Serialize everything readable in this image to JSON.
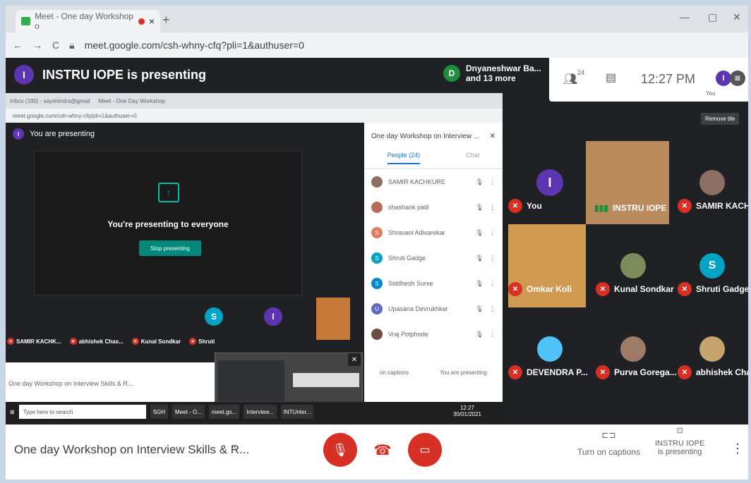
{
  "browser": {
    "tab_title": "Meet - One day Workshop o",
    "url": "meet.google.com/csh-whny-cfq?pli=1&authuser=0",
    "new_tab": "+",
    "tab_close": "×"
  },
  "banner": {
    "presenter_initial": "I",
    "presenter_text": "INSTRU IOPE is presenting"
  },
  "participants_chip": {
    "initial": "D",
    "line1": "Dnyaneshwar Ba...",
    "line2": "and 13 more"
  },
  "topbar": {
    "people_count": "24",
    "time": "12:27 PM",
    "you_label": "You",
    "remove_tile": "Remove tile"
  },
  "shared_screen": {
    "inner_tab1": "Inbox (190) - sayshindra@gmail",
    "inner_tab2": "Meet - One Day Workshop",
    "inner_url": "meet.google.com/csh-whny-cfq/pli=1&authuser=0",
    "you_are_presenting": "You are presenting",
    "presenting_to_everyone": "You're presenting to everyone",
    "stop_presenting": "Stop presenting",
    "panel_title": "One day Workshop on Interview ...",
    "people_tab": "People (24)",
    "chat_tab": "Chat",
    "people": [
      {
        "name": "SAMIR KACHKURE",
        "initial": "",
        "color": "#8d6e63"
      },
      {
        "name": "shashank patil",
        "initial": "",
        "color": "#b56c5a"
      },
      {
        "name": "Shravani Adivarekar",
        "initial": "S",
        "color": "#e07b5f"
      },
      {
        "name": "Shruti Gadge",
        "initial": "S",
        "color": "#00a3c4"
      },
      {
        "name": "Siddhesh Surve",
        "initial": "S",
        "color": "#0288d1"
      },
      {
        "name": "Upasana Devrukhkar",
        "initial": "U",
        "color": "#5c6bc0"
      },
      {
        "name": "Vraj Potphode",
        "initial": "",
        "color": "#6d4c41"
      }
    ],
    "strip": [
      {
        "name": "SAMIR KACHK..."
      },
      {
        "name": "abhishek Chas..."
      },
      {
        "name": "Kunal Sondkar"
      },
      {
        "name": "Shruti"
      }
    ],
    "strip_initial_s": "S",
    "strip_initial_i": "I",
    "meeting_title": "One day Workshop on Interview Skills & R...",
    "captions": "on captions",
    "you_are_presenting_btn": "You are presenting",
    "taskbar": {
      "search": "Type here to search",
      "items": [
        "SGH",
        "Meet - O...",
        "meet.go...",
        "Interview...",
        "INTUnter..."
      ],
      "time": "12:27",
      "date": "30/01/2021"
    }
  },
  "tiles": [
    {
      "name": "You",
      "initial": "I",
      "color": "#5e35b1",
      "type": "avatar"
    },
    {
      "name": "INSTRU IOPE",
      "type": "video"
    },
    {
      "name": "SAMIR KACH...",
      "type": "photo"
    },
    {
      "name": "Omkar Koli",
      "type": "video2"
    },
    {
      "name": "Kunal Sondkar",
      "type": "photo"
    },
    {
      "name": "Shruti Gadge",
      "initial": "S",
      "color": "#00a3c4",
      "type": "avatar"
    },
    {
      "name": "DEVENDRA P...",
      "type": "photo"
    },
    {
      "name": "Purva Gorega...",
      "type": "photo"
    },
    {
      "name": "abhishek Cha...",
      "type": "photo"
    }
  ],
  "bottom": {
    "meeting_title": "One day Workshop on Interview Skills & R...",
    "captions": "Turn on captions",
    "presenting_line1": "INSTRU IOPE",
    "presenting_line2": "is presenting"
  }
}
